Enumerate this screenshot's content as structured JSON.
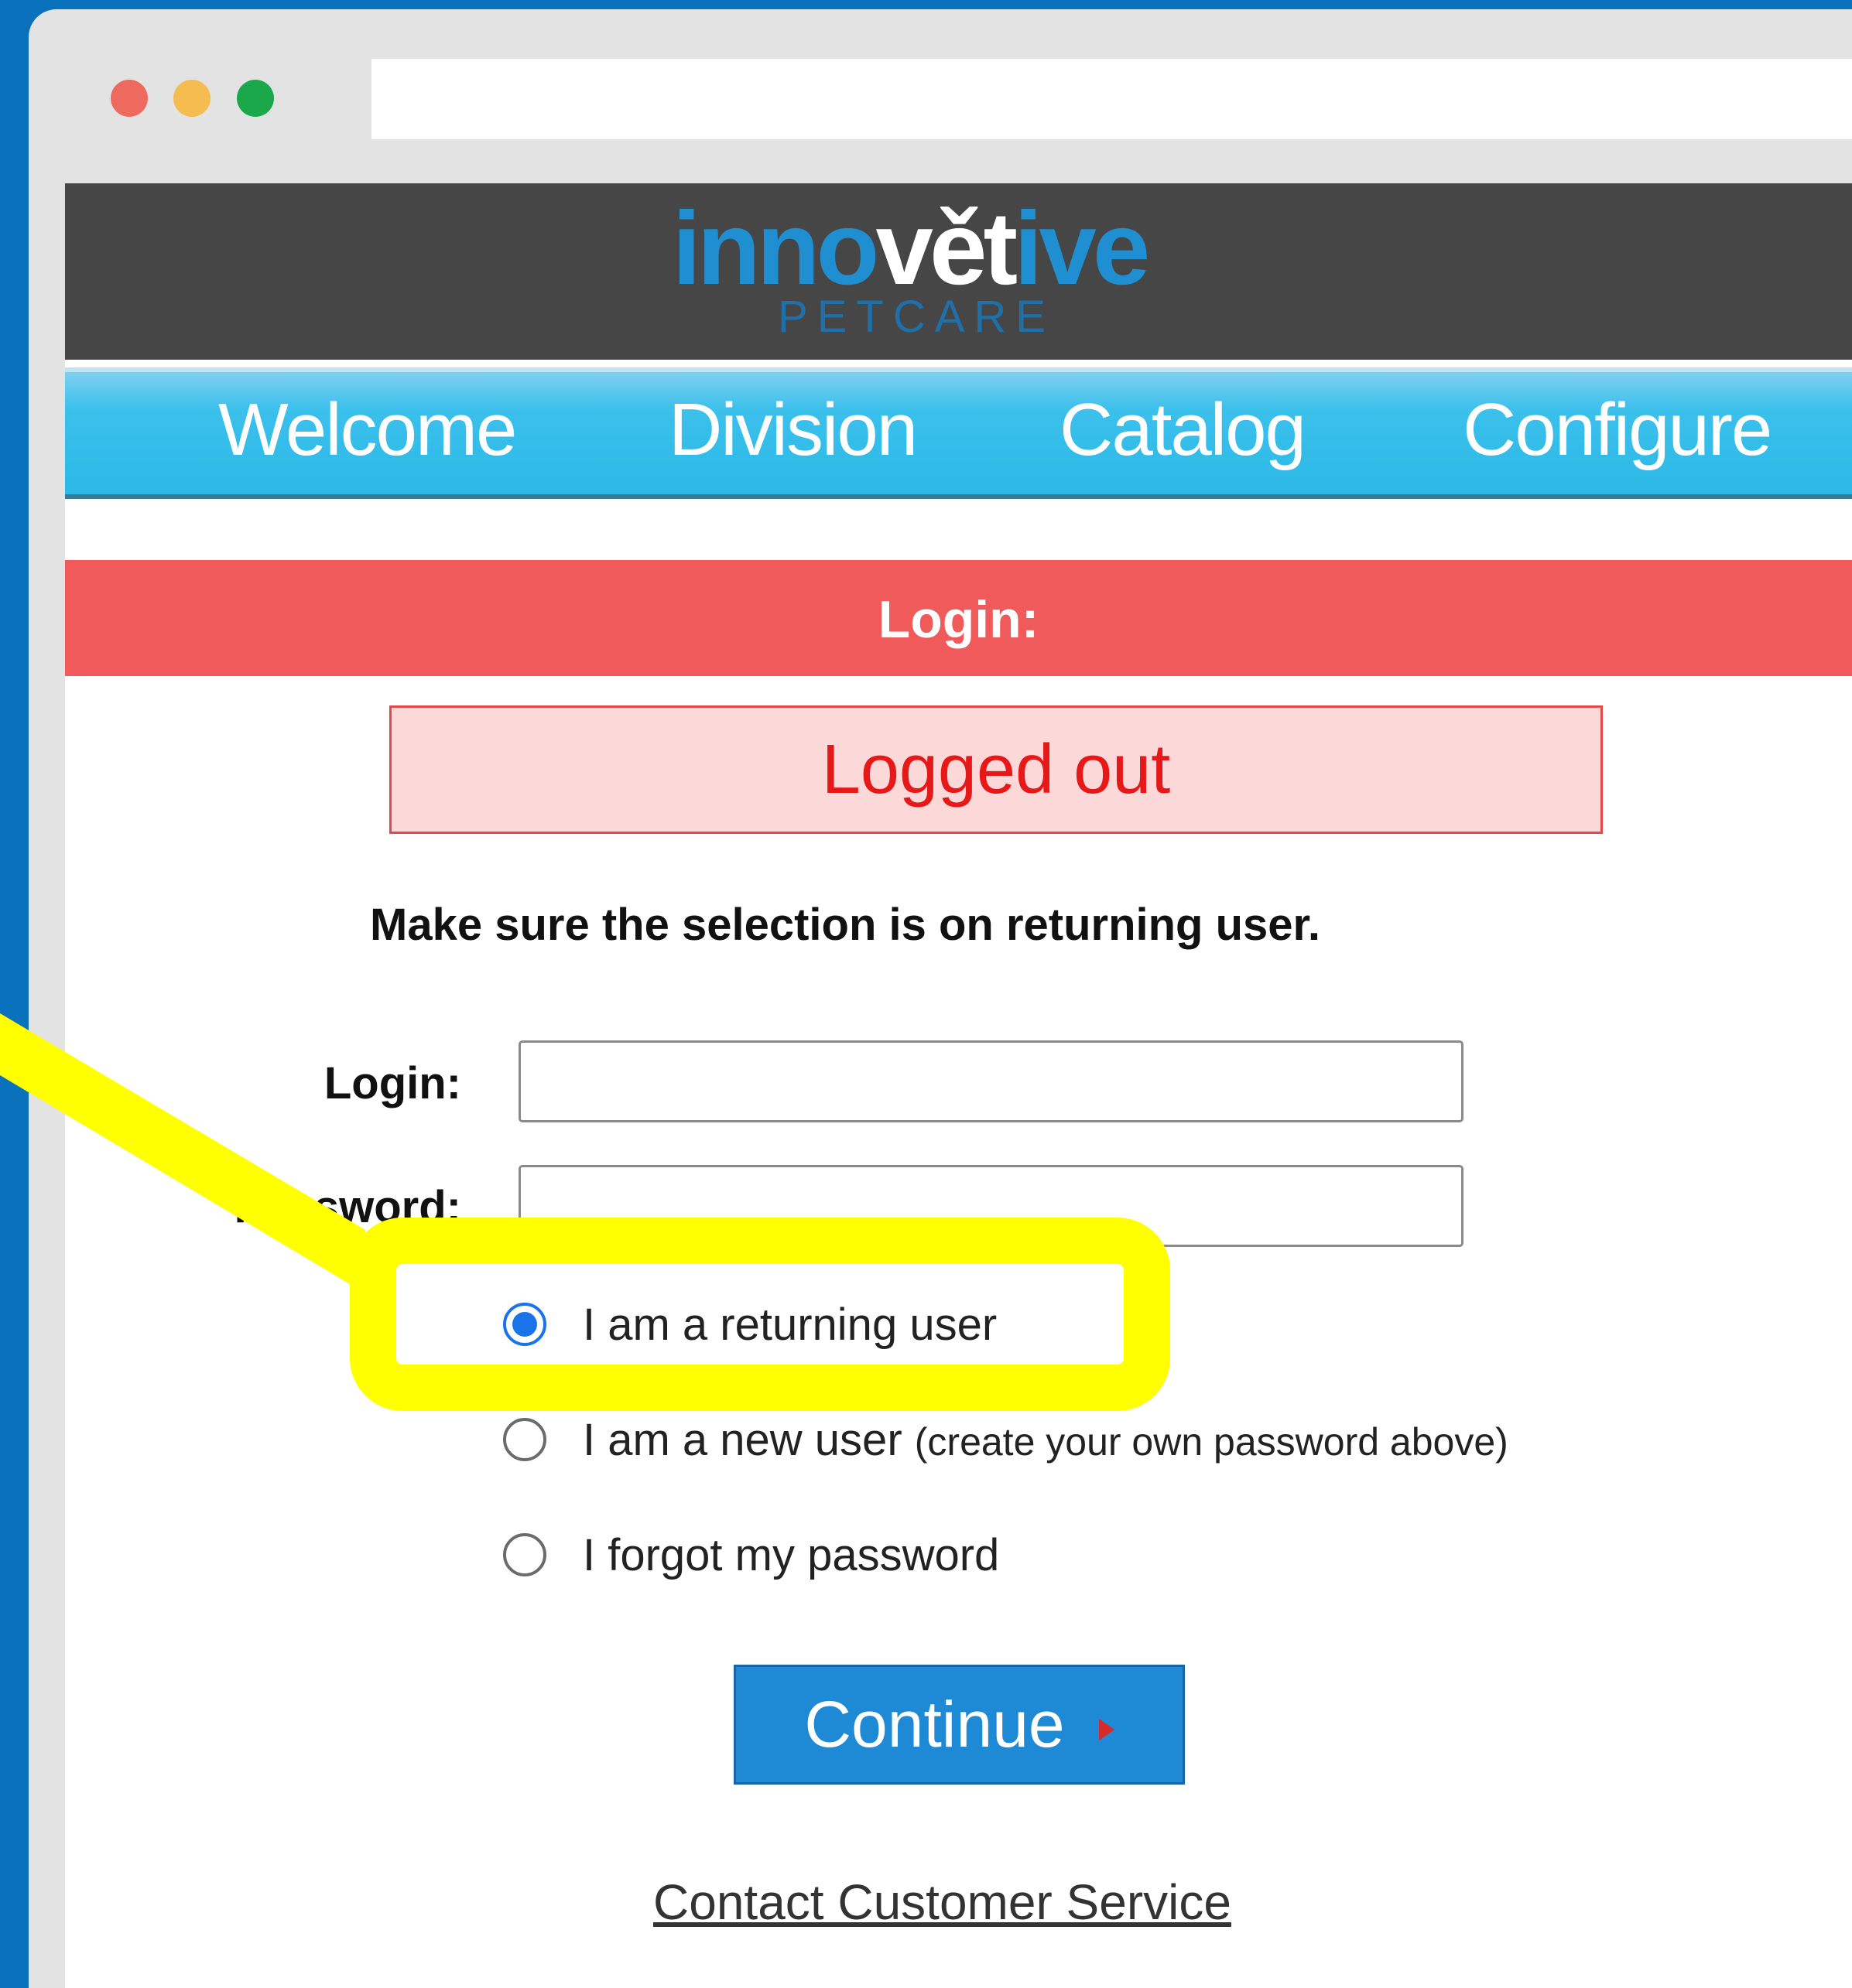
{
  "site": {
    "logo_left": "inno",
    "logo_mid": "vět",
    "logo_right": "ive",
    "logo_sub": "PETCARE"
  },
  "nav": [
    "Welcome",
    "Division",
    "Catalog",
    "Configure"
  ],
  "login_banner": "Login:",
  "status_message": "Logged out",
  "instruction": "Make sure the selection is on returning user.",
  "form": {
    "login_label": "Login:",
    "password_label": "Password:",
    "login_value": "",
    "password_value": ""
  },
  "radios": {
    "returning": "I am a returning user",
    "new_user": "I am a new user",
    "new_user_note": "(create your own password above)",
    "forgot": "I forgot my password",
    "selected": "returning"
  },
  "continue_label": "Continue",
  "contact_link": "Contact Customer Service",
  "colors": {
    "frame_bg": "#0a72bd",
    "header_bg": "#464646",
    "nav_bg": "#2bb9e6",
    "banner_bg": "#f05a5a",
    "alert_bg": "#fdd8d8",
    "alert_text": "#e61818",
    "button_bg": "#1e8ad6",
    "highlight": "#ffff00"
  }
}
